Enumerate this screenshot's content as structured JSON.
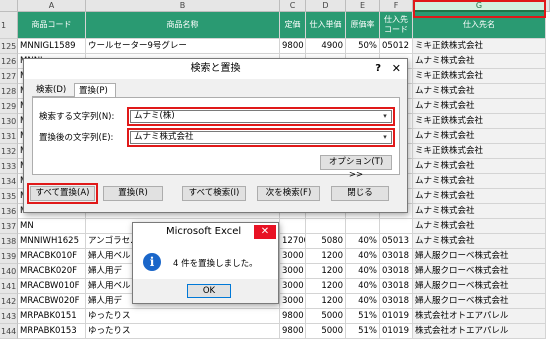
{
  "sheet": {
    "columns": [
      "A",
      "B",
      "C",
      "D",
      "E",
      "F",
      "G"
    ],
    "headers": {
      "a": "商品コード",
      "b": "商品名称",
      "c": "定価",
      "d": "仕入単価",
      "e": "原価率",
      "f1": "仕入先",
      "f2": "コード",
      "g": "仕入先名"
    },
    "header_row_num": "1",
    "rows": [
      {
        "n": "125",
        "a": "MNNIGL1589",
        "b": "ウールセーター9号グレー",
        "c": "9800",
        "d": "4900",
        "e": "50%",
        "f": "05012",
        "g": "ミキ正鉄株式会社"
      },
      {
        "n": "126",
        "a": "MNNI",
        "b": "",
        "c": "",
        "d": "",
        "e": "",
        "f": "",
        "g": "ムナミ株式会社"
      },
      {
        "n": "127",
        "a": "MN",
        "b": "",
        "c": "",
        "d": "",
        "e": "",
        "f": "",
        "g": "ミキ正鉄株式会社"
      },
      {
        "n": "128",
        "a": "MN",
        "b": "",
        "c": "",
        "d": "",
        "e": "",
        "f": "",
        "g": "ムナミ株式会社"
      },
      {
        "n": "129",
        "a": "MN",
        "b": "",
        "c": "",
        "d": "",
        "e": "",
        "f": "",
        "g": "ムナミ株式会社"
      },
      {
        "n": "130",
        "a": "MN",
        "b": "",
        "c": "",
        "d": "",
        "e": "",
        "f": "",
        "g": "ミキ正鉄株式会社"
      },
      {
        "n": "131",
        "a": "MN",
        "b": "",
        "c": "",
        "d": "",
        "e": "",
        "f": "",
        "g": "ムナミ株式会社"
      },
      {
        "n": "132",
        "a": "MN",
        "b": "",
        "c": "",
        "d": "",
        "e": "",
        "f": "",
        "g": "ミキ正鉄株式会社"
      },
      {
        "n": "133",
        "a": "MN",
        "b": "",
        "c": "",
        "d": "",
        "e": "",
        "f": "",
        "g": "ムナミ株式会社"
      },
      {
        "n": "134",
        "a": "MN",
        "b": "",
        "c": "",
        "d": "",
        "e": "",
        "f": "",
        "g": "ムナミ株式会社"
      },
      {
        "n": "135",
        "a": "MN",
        "b": "",
        "c": "",
        "d": "",
        "e": "",
        "f": "",
        "g": "ムナミ株式会社"
      },
      {
        "n": "136",
        "a": "MN",
        "b": "",
        "c": "",
        "d": "",
        "e": "",
        "f": "",
        "g": "ムナミ株式会社"
      },
      {
        "n": "137",
        "a": "MN",
        "b": "",
        "c": "",
        "d": "",
        "e": "",
        "f": "",
        "g": "ムナミ株式会社"
      },
      {
        "n": "138",
        "a": "MNNIWH1625",
        "b": "アンゴラセ…",
        "c": "12700",
        "d": "5080",
        "e": "40%",
        "f": "05013",
        "g": "ムナミ株式会社"
      },
      {
        "n": "139",
        "a": "MRACBK010F",
        "b": "婦人用ベル",
        "c": "3000",
        "d": "1200",
        "e": "40%",
        "f": "03018",
        "g": "婦人服クローベ株式会社"
      },
      {
        "n": "140",
        "a": "MRACBK020F",
        "b": "婦人用デ",
        "c": "3000",
        "d": "1200",
        "e": "40%",
        "f": "03018",
        "g": "婦人服クローベ株式会社"
      },
      {
        "n": "141",
        "a": "MRACBW010F",
        "b": "婦人用ベル",
        "c": "3000",
        "d": "1200",
        "e": "40%",
        "f": "03018",
        "g": "婦人服クローベ株式会社"
      },
      {
        "n": "142",
        "a": "MRACBW020F",
        "b": "婦人用デ",
        "c": "3000",
        "d": "1200",
        "e": "40%",
        "f": "03018",
        "g": "婦人服クローベ株式会社"
      },
      {
        "n": "143",
        "a": "MRPABK0151",
        "b": "ゆったりス",
        "c": "9800",
        "d": "5000",
        "e": "51%",
        "f": "01019",
        "g": "株式会社オトエアパレル"
      },
      {
        "n": "144",
        "a": "MRPABK0153",
        "b": "ゆったりス",
        "c": "9800",
        "d": "5000",
        "e": "51%",
        "f": "01019",
        "g": "株式会社オトエアパレル"
      }
    ]
  },
  "dialog": {
    "title": "検索と置換",
    "help": "?",
    "close": "✕",
    "tab_find": "検索(D)",
    "tab_replace": "置換(P)",
    "find_label": "検索する文字列(N):",
    "find_value": "ムナミ(株)",
    "replace_label": "置換後の文字列(E):",
    "replace_value": "ムナミ株式会社",
    "options_btn": "オプション(T) >>",
    "replace_all_btn": "すべて置換(A)",
    "replace_btn": "置換(R)",
    "find_all_btn": "すべて検索(I)",
    "find_next_btn": "次を検索(F)",
    "close_btn": "閉じる",
    "dropdown": "▾"
  },
  "msgbox": {
    "title": "Microsoft Excel",
    "close": "✕",
    "info": "i",
    "text": "4 件を置換しました。",
    "ok": "OK"
  },
  "colors": {
    "header_green": "#2a9a72",
    "highlight_red": "#e01919"
  }
}
